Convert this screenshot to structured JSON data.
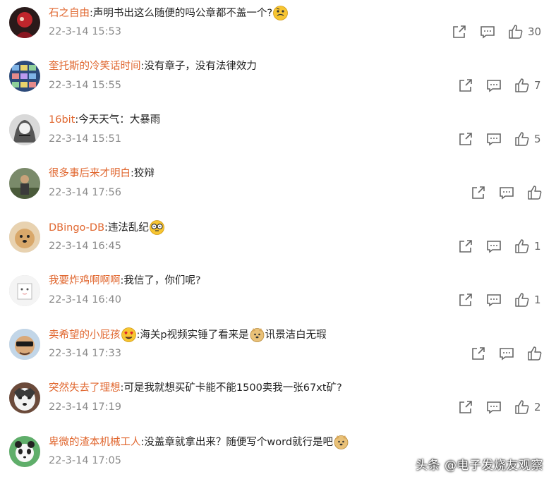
{
  "comments": [
    {
      "name": "石之自由",
      "colon": ":",
      "text": "声明书出这么随便的吗公章都不盖一个?",
      "time": "22-3-14 15:53",
      "likes": "30",
      "emoji_after": "thinking-face-emoji",
      "emoji_before": ""
    },
    {
      "name": "奎托斯的冷笑话时间",
      "colon": ":",
      "text": "没有章子，没有法律效力",
      "time": "22-3-14 15:55",
      "likes": "7",
      "emoji_after": "",
      "emoji_before": ""
    },
    {
      "name": "16bit",
      "colon": ":",
      "text": "今天天气：大暴雨",
      "time": "22-3-14 15:51",
      "likes": "5",
      "emoji_after": "",
      "emoji_before": ""
    },
    {
      "name": "很多事后来才明白",
      "colon": ":",
      "text": "狡辩",
      "time": "22-3-14 17:56",
      "likes": "",
      "emoji_after": "",
      "emoji_before": ""
    },
    {
      "name": "DBingo-DB",
      "colon": ":",
      "text": "违法乱纪",
      "time": "22-3-14 16:45",
      "likes": "1",
      "emoji_after": "glasses-face-emoji",
      "emoji_before": ""
    },
    {
      "name": "我要炸鸡啊啊啊",
      "colon": ":",
      "text": "我信了，你们呢?",
      "time": "22-3-14 16:40",
      "likes": "1",
      "emoji_after": "",
      "emoji_before": ""
    },
    {
      "name": "卖希望的小屁孩",
      "colon": "",
      "text": ":海关p视频实锤了看来是",
      "text2": "讯景洁白无瑕",
      "time": "22-3-14 17:33",
      "likes": "",
      "emoji_after": "",
      "emoji_before": "heart-eyes-emoji"
    },
    {
      "name": "突然失去了理想",
      "colon": ":",
      "text": "可是我就想买矿卡能不能1500卖我一张67xt矿?",
      "time": "22-3-14 17:19",
      "likes": "2",
      "emoji_after": "",
      "emoji_before": ""
    },
    {
      "name": "卑微的渣本机械工人",
      "colon": ":",
      "text": "没盖章就拿出来？随便写个word就行是吧",
      "time": "22-3-14 17:05",
      "likes": "",
      "emoji_after": "doge-emoji",
      "emoji_before": ""
    }
  ],
  "watermark": "头条 @电子发烧友观察",
  "colors": {
    "name": "#e0662e",
    "time": "#8a8a8a",
    "icon": "#666666"
  }
}
